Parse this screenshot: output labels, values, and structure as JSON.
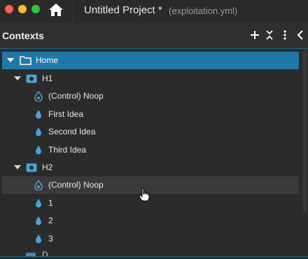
{
  "window": {
    "project_title": "Untitled Project *",
    "file_name": "(exploitation.yml)"
  },
  "panel": {
    "title": "Contexts"
  },
  "tree": {
    "home": "Home",
    "h1": "H1",
    "h1_items": [
      "(Control) Noop",
      "First Idea",
      "Second Idea",
      "Third Idea"
    ],
    "h2": "H2",
    "h2_items": [
      "(Control) Noop",
      "1",
      "2",
      "3"
    ],
    "partial_next": "D"
  },
  "colors": {
    "selected_row": "#1f79a8",
    "accent_blue": "#4aa3d8",
    "hover_row": "#3a3a3a"
  },
  "icons": {
    "home": "home-icon",
    "add": "plus-icon",
    "collapse": "collapse-all-icon",
    "more": "more-vertical-icon",
    "close_panel": "chevron-left-icon",
    "folder": "folder-icon",
    "hypothesis": "hypothesis-icon",
    "control": "control-drop-icon",
    "variant": "drop-icon"
  }
}
